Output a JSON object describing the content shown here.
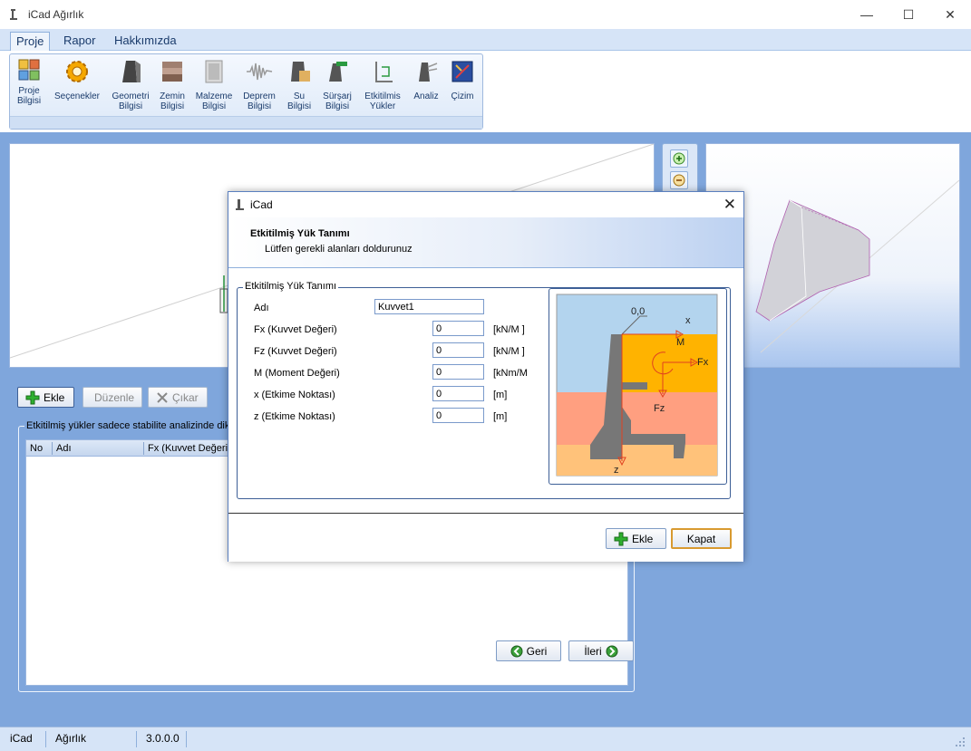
{
  "window": {
    "title": "iCad Ağırlık",
    "minimize": "—",
    "maximize": "☐",
    "close": "✕"
  },
  "tabs": [
    {
      "label": "Proje",
      "active": true
    },
    {
      "label": "Rapor",
      "active": false
    },
    {
      "label": "Hakkımızda",
      "active": false
    }
  ],
  "ribbon": {
    "buttons": [
      {
        "line1": "Proje",
        "line2": "Bilgisi"
      },
      {
        "line1": "Seçenekler",
        "line2": ""
      },
      {
        "line1": "Geometri",
        "line2": "Bilgisi"
      },
      {
        "line1": "Zemin",
        "line2": "Bilgisi"
      },
      {
        "line1": "Malzeme",
        "line2": "Bilgisi"
      },
      {
        "line1": "Deprem",
        "line2": "Bilgisi"
      },
      {
        "line1": "Su",
        "line2": "Bilgisi"
      },
      {
        "line1": "Sürşarj",
        "line2": "Bilgisi"
      },
      {
        "line1": "Etkitilmis",
        "line2": "Yükler"
      },
      {
        "line1": "Analiz",
        "line2": ""
      },
      {
        "line1": "Çizim",
        "line2": ""
      }
    ]
  },
  "lower": {
    "add_label": "Ekle",
    "edit_label": "Düzenle",
    "remove_label": "Çıkar",
    "group_legend": "Etkitilmiş yükler sadece stabilite analizinde dikkate alınmaktadır.",
    "columns": [
      "No",
      "Adı",
      "Fx (Kuvvet Değeri)"
    ],
    "back_label": "Geri",
    "next_label": "İleri"
  },
  "status": {
    "app": "iCad",
    "module": "Ağırlık",
    "version": "3.0.0.0"
  },
  "dialog": {
    "title": "iCad",
    "close": "✕",
    "heading": "Etkitilmiş Yük Tanımı",
    "subheading": "Lütfen gerekli alanları doldurunuz",
    "group_legend": "Etkitilmiş Yük Tanımı",
    "name_label": "Adı",
    "name_value": "Kuvvet1",
    "fields": [
      {
        "label": "Fx (Kuvvet Değeri)",
        "value": "0",
        "unit": "[kN/M ]"
      },
      {
        "label": "Fz (Kuvvet Değeri)",
        "value": "0",
        "unit": "[kN/M ]"
      },
      {
        "label": "M (Moment Değeri)",
        "value": "0",
        "unit": "[kNm/M"
      },
      {
        "label": "x (Etkime Noktası)",
        "value": "0",
        "unit": "[m]"
      },
      {
        "label": "z (Etkime Noktası)",
        "value": "0",
        "unit": "[m]"
      }
    ],
    "figure": {
      "origin": "0,0",
      "x": "x",
      "z": "z",
      "m": "M",
      "fx": "Fx",
      "fz": "Fz"
    },
    "add_label": "Ekle",
    "close_label": "Kapat"
  },
  "colors": {
    "accent": "#7fa6dc",
    "soil_top": "#ffb300",
    "soil_mid": "#ff9f80",
    "soil_bottom": "#ffc27a",
    "wall": "#777777",
    "sky": "#b3d4ee"
  }
}
